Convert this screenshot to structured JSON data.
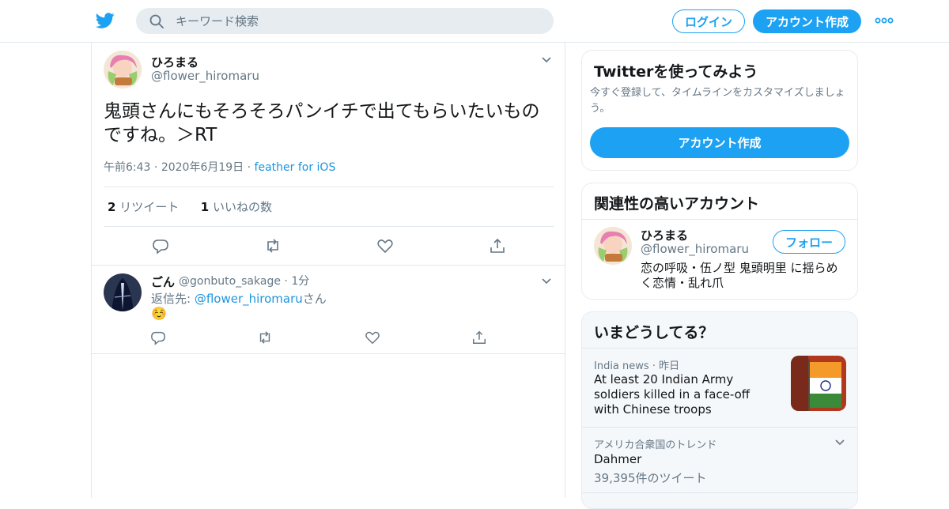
{
  "search": {
    "placeholder": "キーワード検索"
  },
  "header": {
    "login_label": "ログイン",
    "signup_label": "アカウント作成"
  },
  "colors": {
    "accent": "#1da1f2",
    "link": "#1b95e0",
    "muted": "#657786",
    "border": "#e1e8ed"
  },
  "tweet": {
    "name": "ひろまる",
    "handle": "@flower_hiromaru",
    "text": "鬼頭さんにもそろそろパンイチで出てもらいたいものですね。＞RT",
    "time": "午前6:43",
    "date": "2020年6月19日",
    "source": "feather for iOS",
    "retweet_count": "2",
    "retweet_label": "リツイート",
    "like_count": "1",
    "like_label": "いいねの数"
  },
  "reply": {
    "name": "ごん",
    "handle": "@gonbuto_sakage",
    "time": "1分",
    "reply_prefix": "返信先: ",
    "reply_mention": "@flower_hiromaru",
    "reply_suffix": "さん",
    "text": "☺️"
  },
  "signup_card": {
    "title": "Twitterを使ってみよう",
    "subtitle": "今すぐ登録して、タイムラインをカスタマイズしましょう。",
    "button": "アカウント作成"
  },
  "related_card": {
    "title": "関連性の高いアカウント",
    "name": "ひろまる",
    "handle": "@flower_hiromaru",
    "follow_label": "フォロー",
    "bio": "恋の呼吸・伍ノ型 鬼頭明里 に揺らめく恋情・乱れ爪"
  },
  "trends_card": {
    "title": "いまどうしてる？",
    "items": [
      {
        "meta_source": "India news",
        "meta_time": "昨日",
        "title": "At least 20 Indian Army soldiers killed in a face-off with Chinese troops"
      },
      {
        "meta": "アメリカ合衆国のトレンド",
        "title": "Dahmer",
        "count": "39,395件のツイート"
      }
    ]
  }
}
